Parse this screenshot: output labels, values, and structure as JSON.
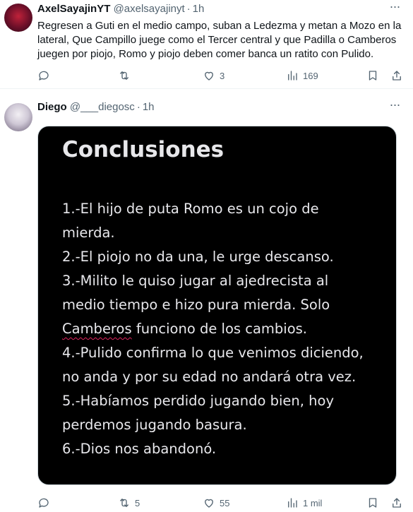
{
  "tweets": [
    {
      "author": {
        "name": "AxelSayajinYT",
        "handle": "@axelsayajinyt",
        "time": "1h"
      },
      "text": "Regresen a Guti en el medio campo, suban a Ledezma y metan a Mozo en la lateral, Que Campillo juege como el Tercer central y que Padilla o Camberos juegen por piojo, Romo y piojo deben comer banca un ratito con Pulido.",
      "actions": {
        "reply": "",
        "retweet": "",
        "like": "3",
        "views": "169"
      }
    },
    {
      "author": {
        "name": "Diego",
        "handle": "@___diegosc",
        "time": "1h"
      },
      "media": {
        "title": "Conclusiones",
        "lines": [
          "1.-El hijo de puta Romo es un cojo de",
          "mierda.",
          "2.-El piojo no da una, le urge descanso.",
          "3.-Milito le quiso jugar al ajedrecista al",
          "medio tiempo e hizo pura mierda. Solo",
          "Camberos",
          " funciono de los cambios.",
          "4.-Pulido confirma lo que venimos diciendo,",
          "no anda y por su edad no andará otra vez.",
          "5.-Habíamos perdido jugando bien, hoy",
          "perdemos jugando basura.",
          "6.-Dios nos abandonó."
        ]
      },
      "actions": {
        "reply": "",
        "retweet": "5",
        "like": "55",
        "views": "1 mil"
      }
    }
  ],
  "colors": {
    "text": "#0f1419",
    "muted": "#536471",
    "border": "#eff3f4",
    "spellcheck": "#e0245e"
  },
  "icons": [
    "more-icon",
    "reply-icon",
    "retweet-icon",
    "like-icon",
    "views-icon",
    "bookmark-icon",
    "share-icon"
  ]
}
